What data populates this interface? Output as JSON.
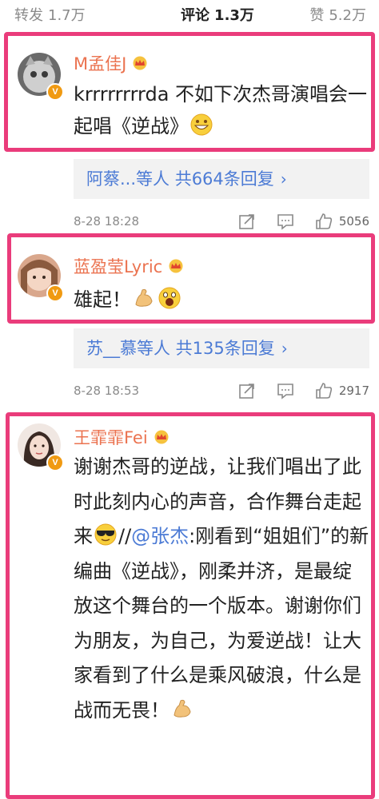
{
  "tabs": [
    {
      "label": "转发",
      "count": "1.7万"
    },
    {
      "label": "评论",
      "count": "1.3万"
    },
    {
      "label": "赞",
      "count": "5.2万"
    }
  ],
  "comments": [
    {
      "username": "M孟佳J",
      "text": "krrrrrrrrda 不如下次杰哥演唱会一起唱《逆战》",
      "reply_summary": "阿蔡...等人 共664条回复",
      "time": "8-28 18:28",
      "likes": "5056"
    },
    {
      "username": "蓝盈莹Lyric",
      "text": "雄起！",
      "reply_summary": "苏__慕等人 共135条回复",
      "time": "8-28 18:53",
      "likes": "2917"
    },
    {
      "username": "王霏霏Fei",
      "text_part1": "谢谢杰哥的逆战，让我们唱出了此时此刻内心的声音，合作舞台走起来",
      "mention_prefix": "//",
      "mention": "@张杰",
      "text_part2": ":刚看到“姐姐们”的新编曲《逆战》，刚柔并济，是最绽放这个舞台的一个版本。谢谢你们为朋友，为自己，为爱逆战！让大家看到了什么是乘风破浪，什么是战而无畏！"
    }
  ],
  "colors": {
    "highlight_border": "#ea3c7b",
    "username": "#eb7350",
    "link": "#4c7bd5"
  },
  "icons": [
    "verified-badge-icon",
    "member-crown-icon",
    "repost-icon",
    "comment-icon",
    "thumbs-up-icon",
    "chevron-right-icon"
  ]
}
